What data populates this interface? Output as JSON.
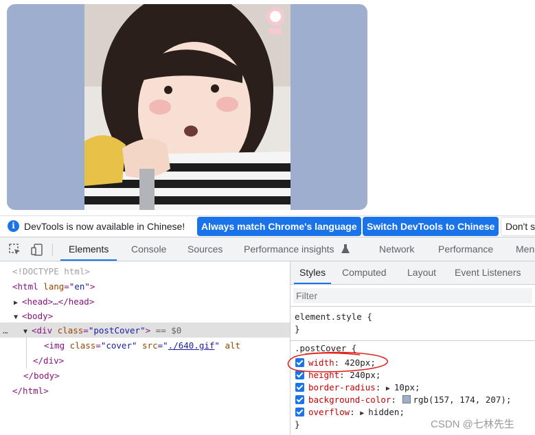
{
  "notice": {
    "text": "DevTools is now available in Chinese!",
    "button_match": "Always match Chrome's language",
    "button_switch": "Switch DevTools to Chinese",
    "button_dont": "Don't s"
  },
  "tabs": [
    "Elements",
    "Console",
    "Sources",
    "Performance insights",
    "Network",
    "Performance",
    "Men"
  ],
  "dom": {
    "doctype": "<!DOCTYPE html>",
    "html_open_tag": "<html",
    "html_lang_attr": "lang",
    "html_lang_val": "\"en\"",
    "tag_close": ">",
    "head": "<head>…</head>",
    "body_open": "<body>",
    "div_open_tag": "<div",
    "class_attr": "class",
    "div_class_val": "\"postCover\"",
    "selected_marker": "== $0",
    "ellipsis": "…",
    "img_open_tag": "<img",
    "img_class_val": "\"cover\"",
    "src_attr": "src",
    "src_q1": "=\"",
    "src_link": "./640.gif",
    "src_q2": "\"",
    "alt_attr": "alt",
    "div_close": "</div>",
    "body_close": "</body>",
    "html_close": "</html>",
    "eq": "="
  },
  "styles": {
    "subtabs": [
      "Styles",
      "Computed",
      "Layout",
      "Event Listeners"
    ],
    "filter_placeholder": "Filter",
    "element_style_selector": "element.style {",
    "close_brace": "}",
    "rule_selector": ".postCover {",
    "declarations": [
      {
        "prop": "width",
        "value": "420px"
      },
      {
        "prop": "height",
        "value": "240px"
      },
      {
        "prop": "border-radius",
        "value": "10px"
      },
      {
        "prop": "background-color",
        "value": "rgb(157, 174, 207)"
      },
      {
        "prop": "overflow",
        "value": "hidden"
      }
    ]
  },
  "colors": {
    "post_cover_bg": "#9daecf",
    "accent": "#1a73e8",
    "annotation": "#e0231c"
  },
  "watermark": "CSDN @七林先生"
}
